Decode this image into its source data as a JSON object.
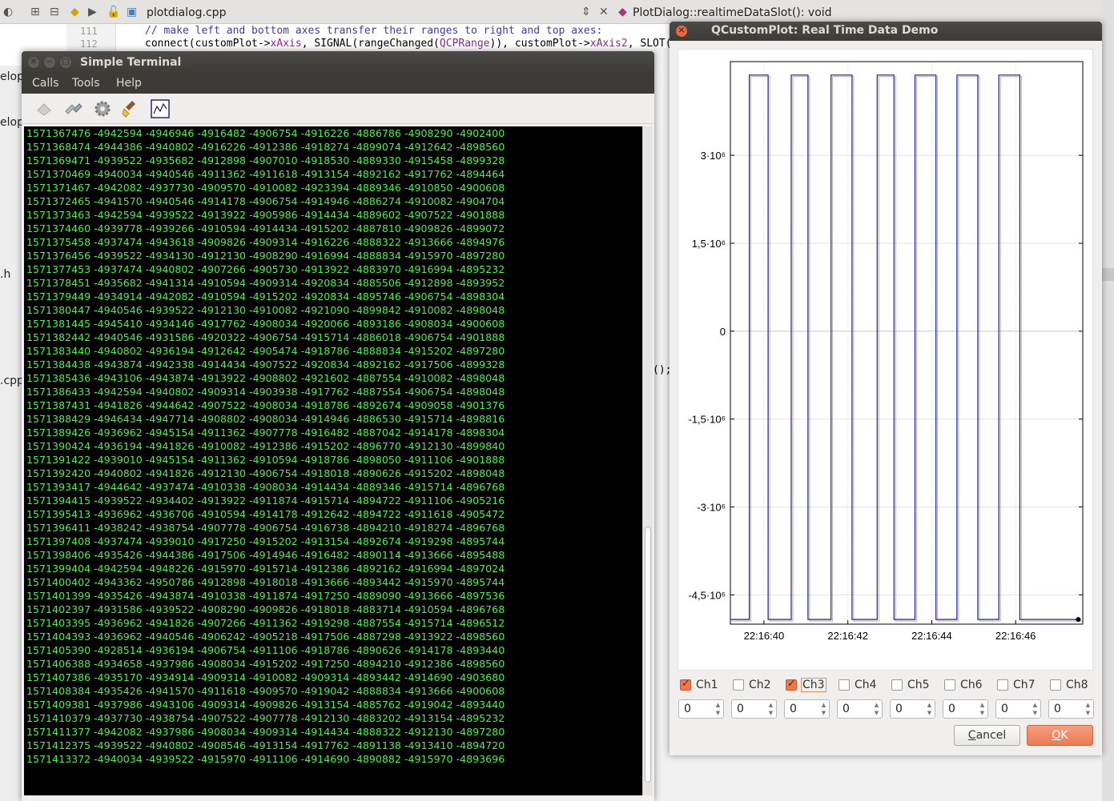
{
  "ide": {
    "file_name": "plotdialog.cpp",
    "function_signature": "PlotDialog::realtimeDataSlot(): void",
    "line_numbers": [
      "111",
      "112"
    ],
    "code_comment": "// make left and bottom axes transfer their ranges to right and top axes:",
    "code_line_parts": [
      "connect(customPlot->",
      "xAxis",
      ", ",
      "SIGNAL",
      "(rangeChanged(",
      "QCPRange",
      ")), customPlot->",
      "xAxis2",
      ", ",
      "SLOT",
      "("
    ],
    "side_fragments": [
      "elop",
      "elop",
      ".h",
      ".cpp"
    ],
    "code_fragment_right": "();"
  },
  "terminal": {
    "title": "Simple Terminal",
    "menu": [
      "Calls",
      "Tools",
      "Help"
    ],
    "toolbar_icons": [
      "connect-icon",
      "disconnect-icon",
      "settings-icon",
      "clear-icon",
      "plot-icon"
    ],
    "lines": [
      "1571367476 -4942594 -4946946 -4916482 -4906754 -4916226 -4886786 -4908290 -4902400",
      "1571368474 -4944386 -4940802 -4916226 -4912386 -4918274 -4899074 -4912642 -4898560",
      "1571369471 -4939522 -4935682 -4912898 -4907010 -4918530 -4889330 -4915458 -4899328",
      "1571370469 -4940034 -4940546 -4911362 -4911618 -4913154 -4892162 -4917762 -4894464",
      "1571371467 -4942082 -4937730 -4909570 -4910082 -4923394 -4889346 -4910850 -4900608",
      "1571372465 -4941570 -4940546 -4914178 -4906754 -4914946 -4886274 -4910082 -4904704",
      "1571373463 -4942594 -4939522 -4913922 -4905986 -4914434 -4889602 -4907522 -4901888",
      "1571374460 -4939778 -4939266 -4910594 -4914434 -4915202 -4887810 -4909826 -4899072",
      "1571375458 -4937474 -4943618 -4909826 -4909314 -4916226 -4888322 -4913666 -4894976",
      "1571376456 -4939522 -4934130 -4912130 -4908290 -4916994 -4888834 -4915970 -4897280",
      "1571377453 -4937474 -4940802 -4907266 -4905730 -4913922 -4883970 -4916994 -4895232",
      "1571378451 -4935682 -4941314 -4910594 -4909314 -4920834 -4885506 -4912898 -4893952",
      "1571379449 -4934914 -4942082 -4910594 -4915202 -4920834 -4895746 -4906754 -4898304",
      "1571380447 -4940546 -4939522 -4912130 -4910082 -4921090 -4899842 -4910082 -4898048",
      "1571381445 -4945410 -4934146 -4917762 -4908034 -4920066 -4893186 -4908034 -4900608",
      "1571382442 -4940546 -4931586 -4920322 -4906754 -4915714 -4886018 -4906754 -4901888",
      "1571383440 -4940802 -4936194 -4912642 -4905474 -4918786 -4888834 -4915202 -4897280",
      "1571384438 -4943874 -4942338 -4914434 -4907522 -4920834 -4892162 -4917506 -4899328",
      "1571385436 -4943106 -4943874 -4913922 -4908802 -4921602 -4887554 -4910082 -4898048",
      "1571386433 -4942594 -4940802 -4909314 -4903938 -4917762 -4887554 -4906754 -4898048",
      "1571387431 -4941826 -4944642 -4907522 -4908034 -4918786 -4892674 -4909058 -4901376",
      "1571388429 -4946434 -4947714 -4908802 -4908034 -4914946 -4886530 -4915714 -4898816",
      "1571389426 -4936962 -4945154 -4911362 -4907778 -4916482 -4887042 -4914178 -4898304",
      "1571390424 -4936194 -4941826 -4910082 -4912386 -4915202 -4896770 -4912130 -4899840",
      "1571391422 -4939010 -4945154 -4911362 -4910594 -4918786 -4898050 -4911106 -4901888",
      "1571392420 -4940802 -4941826 -4912130 -4906754 -4918018 -4890626 -4915202 -4898048",
      "1571393417 -4944642 -4937474 -4910338 -4908034 -4914434 -4889346 -4915714 -4896768",
      "1571394415 -4939522 -4934402 -4913922 -4911874 -4915714 -4894722 -4911106 -4905216",
      "1571395413 -4936962 -4936706 -4910594 -4914178 -4912642 -4894722 -4911618 -4905472",
      "1571396411 -4938242 -4938754 -4907778 -4906754 -4916738 -4894210 -4918274 -4896768",
      "1571397408 -4937474 -4939010 -4917250 -4915202 -4913154 -4892674 -4919298 -4895744",
      "1571398406 -4935426 -4944386 -4917506 -4914946 -4916482 -4890114 -4913666 -4895488",
      "1571399404 -4942594 -4948226 -4915970 -4915714 -4912386 -4892162 -4916994 -4897024",
      "1571400402 -4943362 -4950786 -4912898 -4918018 -4913666 -4893442 -4915970 -4895744",
      "1571401399 -4935426 -4943874 -4910338 -4911874 -4917250 -4889090 -4913666 -4897536",
      "1571402397 -4931586 -4939522 -4908290 -4909826 -4918018 -4883714 -4910594 -4896768",
      "1571403395 -4936962 -4941826 -4907266 -4911362 -4919298 -4887554 -4915714 -4896512",
      "1571404393 -4936962 -4940546 -4906242 -4905218 -4917506 -4887298 -4913922 -4898560",
      "1571405390 -4928514 -4936194 -4906754 -4911106 -4918786 -4890626 -4914178 -4893440",
      "1571406388 -4934658 -4937986 -4908034 -4915202 -4917250 -4894210 -4912386 -4898560",
      "1571407386 -4935170 -4934914 -4909314 -4910082 -4909314 -4893442 -4914690 -4903680",
      "1571408384 -4935426 -4941570 -4911618 -4909570 -4919042 -4888834 -4913666 -4900608",
      "1571409381 -4937986 -4943106 -4909314 -4909826 -4913154 -4885762 -4919042 -4893440",
      "1571410379 -4937730 -4938754 -4907522 -4907778 -4912130 -4883202 -4913154 -4895232",
      "1571411377 -4942082 -4937986 -4908034 -4909314 -4914434 -4888322 -4912130 -4897280",
      "1571412375 -4939522 -4940802 -4908546 -4913154 -4917762 -4891138 -4913410 -4894720",
      "1571413372 -4940034 -4939522 -4915970 -4911106 -4914690 -4890882 -4915970 -4893696"
    ]
  },
  "plot_dialog": {
    "title": "QCustomPlot: Real Time Data Demo",
    "channels": [
      {
        "label": "Ch1",
        "checked": true,
        "value": "0"
      },
      {
        "label": "Ch2",
        "checked": false,
        "value": "0"
      },
      {
        "label": "Ch3",
        "checked": true,
        "value": "0"
      },
      {
        "label": "Ch4",
        "checked": false,
        "value": "0"
      },
      {
        "label": "Ch5",
        "checked": false,
        "value": "0"
      },
      {
        "label": "Ch6",
        "checked": false,
        "value": "0"
      },
      {
        "label": "Ch7",
        "checked": false,
        "value": "0"
      },
      {
        "label": "Ch8",
        "checked": false,
        "value": "0"
      }
    ],
    "cancel_label": "Cancel",
    "ok_label": "OK"
  },
  "chart_data": {
    "type": "line",
    "title": "",
    "xlabel": "",
    "ylabel": "",
    "xlim": [
      39.2,
      47.6
    ],
    "ylim": [
      -5000000,
      4600000
    ],
    "x_ticks": [
      40,
      42,
      44,
      46
    ],
    "x_tick_labels": [
      "22:16:40",
      "22:16:42",
      "22:16:44",
      "22:16:46"
    ],
    "y_ticks": [
      3000000,
      1500000,
      0,
      -1500000,
      -3000000,
      -4500000
    ],
    "y_tick_labels": [
      "3·10⁶",
      "1,5·10⁶",
      "0",
      "-1,5·10⁶",
      "-3·10⁶",
      "-4,5·10⁶"
    ],
    "grid": true,
    "line_color": "#1a1a8a",
    "series": [
      {
        "x": [
          39.2,
          39.65,
          39.65,
          40.1,
          40.1,
          40.65,
          40.65,
          41.05,
          41.05,
          41.6,
          41.6,
          42.1,
          42.1,
          42.7,
          42.7,
          43.1,
          43.1,
          43.6,
          43.6,
          44.1,
          44.1,
          44.6,
          44.6,
          45.1,
          45.1,
          45.6,
          45.6,
          46.1,
          46.1,
          46.7,
          46.7,
          47.55
        ],
        "y": [
          -4920000,
          -4920000,
          4370000,
          4370000,
          -4920000,
          -4920000,
          4370000,
          4370000,
          -4920000,
          -4920000,
          4370000,
          4370000,
          -4920000,
          -4920000,
          4370000,
          4370000,
          -4920000,
          -4920000,
          4370000,
          4370000,
          -4920000,
          -4920000,
          4370000,
          4370000,
          -4920000,
          -4920000,
          4370000,
          4370000,
          -4920000,
          -4920000,
          -4920000,
          -4920000
        ]
      }
    ]
  }
}
